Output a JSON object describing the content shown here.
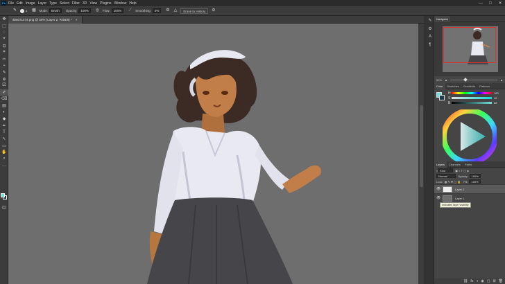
{
  "app": {
    "logo": "Ps",
    "menus": [
      "File",
      "Edit",
      "Image",
      "Layer",
      "Type",
      "Select",
      "Filter",
      "3D",
      "View",
      "Plugins",
      "Window",
      "Help"
    ],
    "window_controls": [
      "—",
      "□",
      "✕"
    ]
  },
  "options_bar": {
    "tool_icon": "brush-tool-icon",
    "brush_size": "1",
    "mode_label": "Mode:",
    "mode_value": "Brush",
    "opacity_label": "Opacity:",
    "opacity_value": "100%",
    "flow_label": "Flow:",
    "flow_value": "100%",
    "smoothing_label": "Smoothing:",
    "smoothing_value": "0%",
    "erase_history": "Erase to History"
  },
  "document": {
    "tab_title": "ab5071474.png @ 50% (Layer 2, RGB/8) *",
    "close": "×"
  },
  "tools": [
    "✥",
    "⬚",
    "◌",
    "⌖",
    "⊡",
    "⌗",
    "✂",
    "⌁",
    "✎",
    "⊕",
    "⎚",
    "✐",
    "⌫",
    "▤",
    "◐",
    "◆",
    "✒",
    "T",
    "↖",
    "▭",
    "✋",
    "⌕",
    "…"
  ],
  "navigator": {
    "tabs": [
      "Navigator"
    ],
    "zoom": "50%"
  },
  "color_panel": {
    "tabs": [
      "Color",
      "Swatches",
      "Gradients",
      "Patterns"
    ],
    "sliders": [
      {
        "label": "H",
        "value": "180"
      },
      {
        "label": "S",
        "value": "48"
      },
      {
        "label": "B",
        "value": "88"
      }
    ],
    "fg_color": "#6ee0dc",
    "bg_color": "#1f3b4d"
  },
  "layers_panel": {
    "tabs": [
      "Layers",
      "Channels",
      "Paths"
    ],
    "kind": "Kind",
    "blend": "Normal",
    "opacity_label": "Opacity:",
    "opacity_value": "100%",
    "lock_label": "Lock:",
    "fill_label": "Fill:",
    "fill_value": "100%",
    "layers": [
      {
        "name": "Layer 2",
        "selected": true
      },
      {
        "name": "Layer 1",
        "selected": false
      }
    ],
    "tooltip": "Indicates layer visibility",
    "bottom_icons": [
      "⛓",
      "fx",
      "◑",
      "◉",
      "▢",
      "⊞",
      "🗑"
    ]
  }
}
